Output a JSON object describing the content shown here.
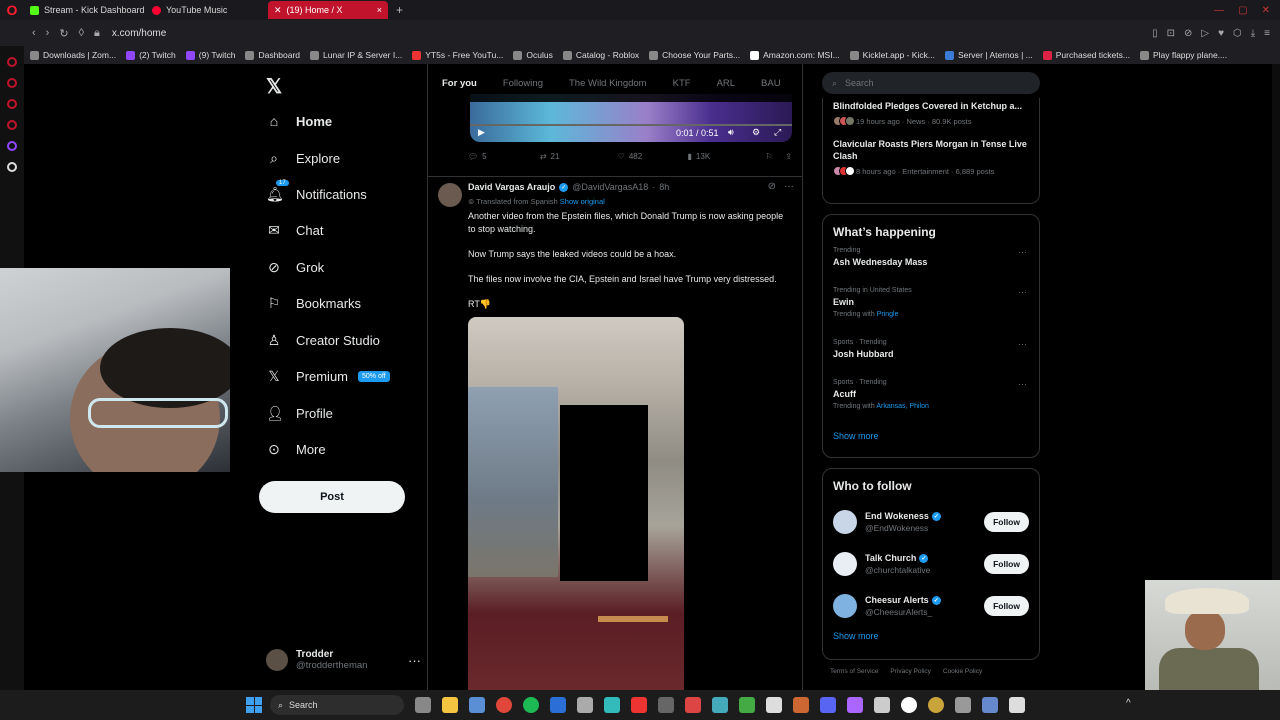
{
  "browser": {
    "tabs": [
      {
        "label": "Stream - Kick Dashboard",
        "color": "#53fc18"
      },
      {
        "label": "YouTube Music",
        "color": "#ff0033"
      },
      {
        "label": "(19) Home / X",
        "color": "#ffffff"
      }
    ],
    "url": "x.com/home",
    "bookmarks": [
      "Downloads | Zom...",
      "(2) Twitch",
      "(9) Twitch",
      "Dashboard",
      "Lunar IP & Server I...",
      "YT5s - Free YouTu...",
      "Oculus",
      "Catalog - Roblox",
      "Choose Your Parts...",
      "Amazon.com: MSI...",
      "Kicklet.app - Kick...",
      "Server | Aternos | ...",
      "Purchased tickets...",
      "Play flappy plane...."
    ]
  },
  "nav": {
    "items": [
      {
        "label": "Home",
        "icon": "home-icon"
      },
      {
        "label": "Explore",
        "icon": "search-icon"
      },
      {
        "label": "Notifications",
        "icon": "bell-icon"
      },
      {
        "label": "Chat",
        "icon": "mail-icon"
      },
      {
        "label": "Grok",
        "icon": "grok-icon"
      },
      {
        "label": "Bookmarks",
        "icon": "bookmark-icon"
      },
      {
        "label": "Creator Studio",
        "icon": "creator-icon"
      },
      {
        "label": "Premium",
        "icon": "x-premium-icon"
      },
      {
        "label": "Profile",
        "icon": "person-icon"
      },
      {
        "label": "More",
        "icon": "more-circle-icon"
      }
    ],
    "notif_badge": "17",
    "premium_badge": "50% off",
    "post_label": "Post",
    "me": {
      "name": "Trodder",
      "handle": "@troddertheman"
    }
  },
  "feed": {
    "tabs": [
      "For you",
      "Following",
      "The Wild Kingdom",
      "KTF",
      "ARL",
      "BAU"
    ],
    "active_tab": "For you",
    "prev_video": {
      "time": "0:01 / 0:51"
    },
    "prev_actions": {
      "replies": "5",
      "reposts": "21",
      "likes": "482",
      "views": "13K"
    },
    "tweet": {
      "name": "David Vargas Araujo",
      "handle": "@DavidVargasA18",
      "time": "8h",
      "translated": "Translated from Spanish",
      "show_original": "Show original",
      "paragraphs": [
        "Another video from the Epstein files, which Donald Trump is now asking people to stop watching.",
        "Now Trump says the leaked videos could be a hoax.",
        "The files now involve the CIA, Epstein and Israel have Trump very distressed.",
        "RT👎"
      ]
    }
  },
  "right": {
    "search_placeholder": "Search",
    "news": [
      {
        "title": "Blindfolded Pledges Covered in Ketchup a...",
        "meta": "19 hours ago · News · 80.9K posts"
      },
      {
        "title": "Clavicular Roasts Piers Morgan in Tense Live Clash",
        "meta": "8 hours ago · Entertainment · 6,889 posts"
      }
    ],
    "happening_title": "What’s happening",
    "trends": [
      {
        "context": "Trending",
        "name": "Ash Wednesday Mass",
        "with": "",
        "links": ""
      },
      {
        "context": "Trending in United States",
        "name": "Ewin",
        "with": "Trending with",
        "links": "Pringle"
      },
      {
        "context": "Sports · Trending",
        "name": "Josh Hubbard",
        "with": "",
        "links": ""
      },
      {
        "context": "Sports · Trending",
        "name": "Acuff",
        "with": "Trending with",
        "links": "Arkansas, Philon"
      }
    ],
    "show_more": "Show more",
    "who_title": "Who to follow",
    "follow": [
      {
        "name": "End Wokeness",
        "handle": "@EndWokeness",
        "color": "#c9d6e8"
      },
      {
        "name": "Talk Church",
        "handle": "@churchtalkative",
        "color": "#e8eef4"
      },
      {
        "name": "Cheesur Alerts",
        "handle": "@CheesurAlerts_",
        "color": "#7fb2e0"
      }
    ],
    "follow_label": "Follow",
    "footer": [
      "Terms of Service",
      "Privacy Policy",
      "Cookie Policy"
    ]
  },
  "taskbar": {
    "search": "Search"
  }
}
